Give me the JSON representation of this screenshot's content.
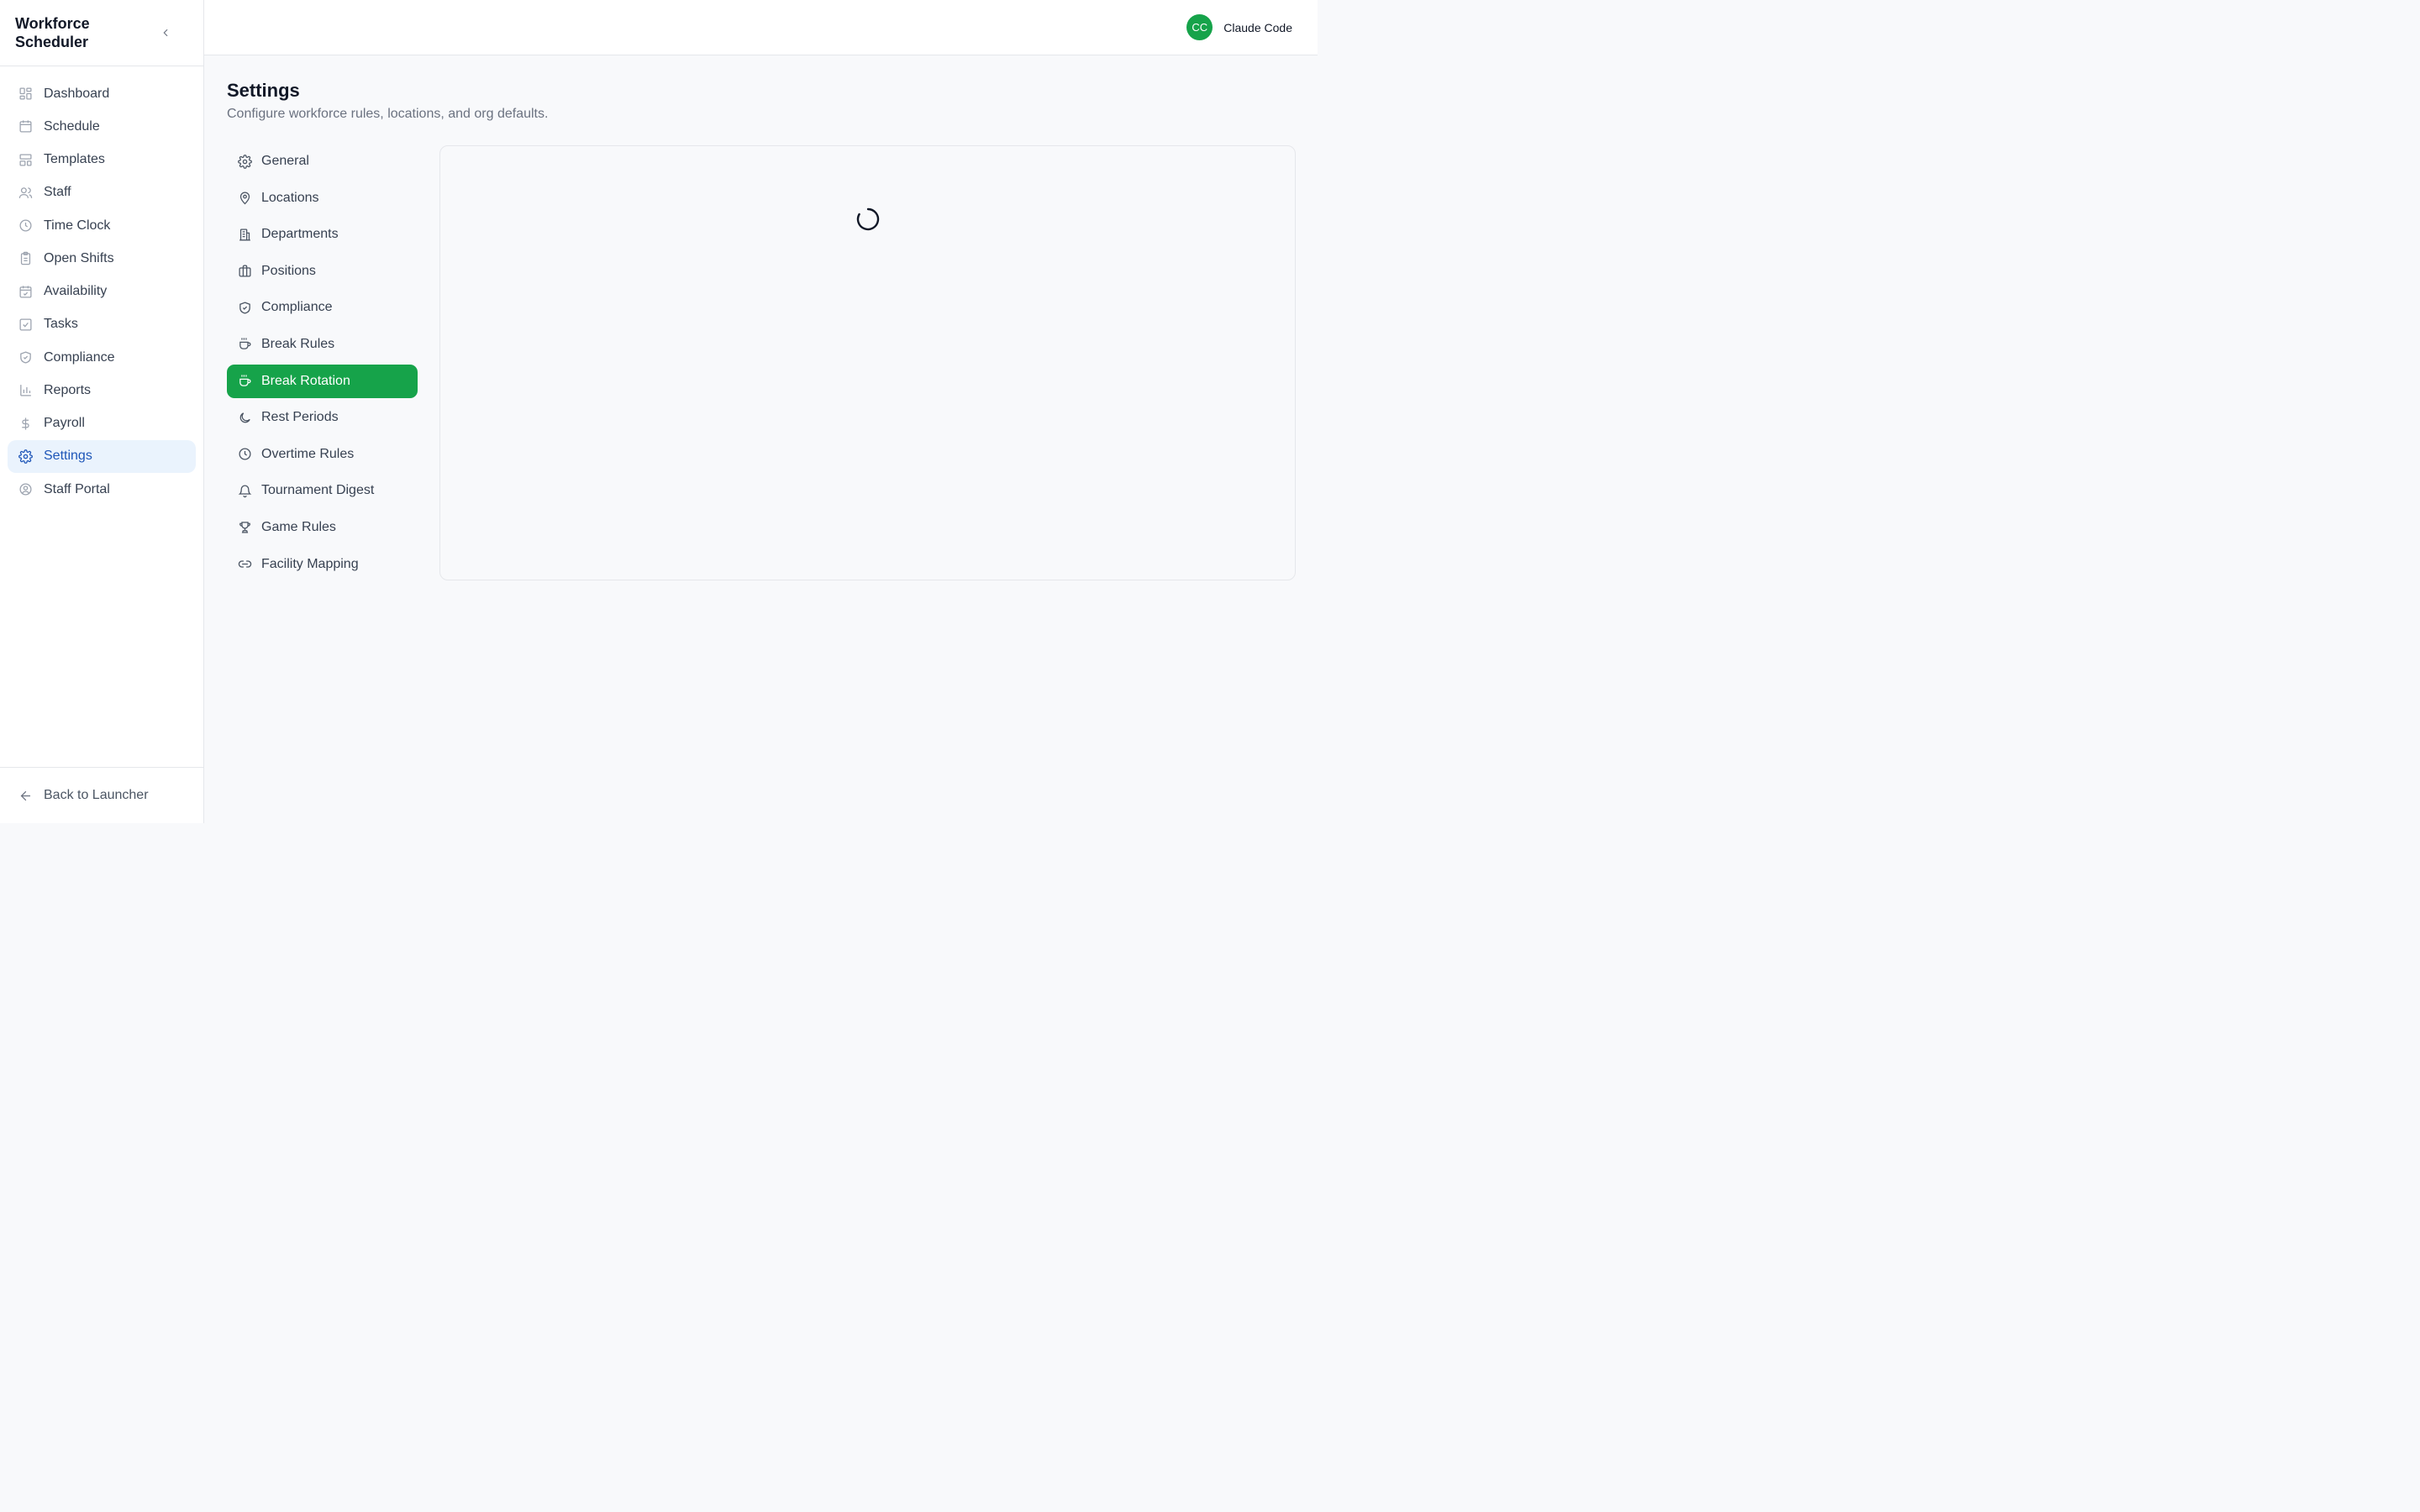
{
  "app": {
    "title": "Workforce Scheduler"
  },
  "sidebar": {
    "items": [
      {
        "label": "Dashboard",
        "icon": "dashboard-icon"
      },
      {
        "label": "Schedule",
        "icon": "calendar-icon"
      },
      {
        "label": "Templates",
        "icon": "templates-icon"
      },
      {
        "label": "Staff",
        "icon": "users-icon"
      },
      {
        "label": "Time Clock",
        "icon": "clock-icon"
      },
      {
        "label": "Open Shifts",
        "icon": "clipboard-icon"
      },
      {
        "label": "Availability",
        "icon": "calendar-check-icon"
      },
      {
        "label": "Tasks",
        "icon": "checkbox-icon"
      },
      {
        "label": "Compliance",
        "icon": "shield-icon"
      },
      {
        "label": "Reports",
        "icon": "bar-chart-icon"
      },
      {
        "label": "Payroll",
        "icon": "dollar-icon"
      },
      {
        "label": "Settings",
        "icon": "gear-icon",
        "active": true
      },
      {
        "label": "Staff Portal",
        "icon": "user-circle-icon"
      }
    ],
    "footer_label": "Back to Launcher"
  },
  "header": {
    "avatar_initials": "CC",
    "user_name": "Claude Code"
  },
  "page": {
    "title": "Settings",
    "subtitle": "Configure workforce rules, locations, and org defaults."
  },
  "settings_nav": {
    "items": [
      {
        "label": "General",
        "icon": "gear-icon"
      },
      {
        "label": "Locations",
        "icon": "map-pin-icon"
      },
      {
        "label": "Departments",
        "icon": "building-icon"
      },
      {
        "label": "Positions",
        "icon": "briefcase-icon"
      },
      {
        "label": "Compliance",
        "icon": "shield-check-icon"
      },
      {
        "label": "Break Rules",
        "icon": "coffee-icon"
      },
      {
        "label": "Break Rotation",
        "icon": "coffee-icon",
        "active": true
      },
      {
        "label": "Rest Periods",
        "icon": "moon-icon"
      },
      {
        "label": "Overtime Rules",
        "icon": "clock-icon"
      },
      {
        "label": "Tournament Digest",
        "icon": "bell-icon"
      },
      {
        "label": "Game Rules",
        "icon": "trophy-icon"
      },
      {
        "label": "Facility Mapping",
        "icon": "link-icon"
      }
    ]
  },
  "colors": {
    "accent_green": "#16a34a",
    "active_sidebar_bg": "#eaf3fd",
    "active_sidebar_text": "#1e56b8"
  },
  "content": {
    "state": "loading"
  }
}
